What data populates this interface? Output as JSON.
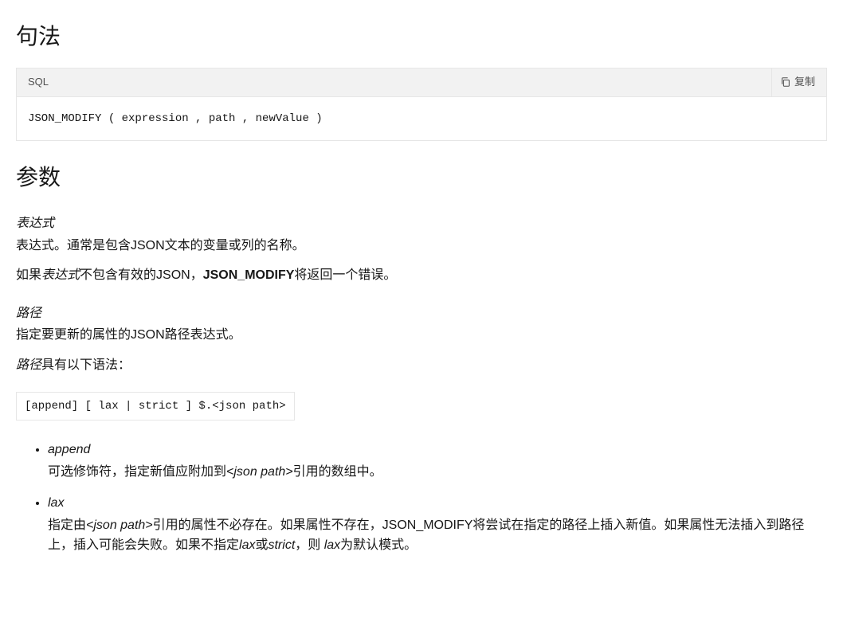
{
  "syntax": {
    "heading": "句法",
    "lang_label": "SQL",
    "copy_label": "复制",
    "code": "JSON_MODIFY ( expression , path , newValue )"
  },
  "params": {
    "heading": "参数",
    "expr": {
      "term": "表达式",
      "desc": "表达式。通常是包含JSON文本的变量或列的名称。",
      "err_prefix": "如果",
      "err_expr": "表达式",
      "err_mid1": "不包含有效的JSON，",
      "err_strong": "JSON_MODIFY",
      "err_suffix": "将返回一个错误。"
    },
    "path": {
      "term": "路径",
      "desc": "指定要更新的属性的JSON路径表达式。",
      "syntax_intro_prefix": "路径",
      "syntax_intro_suffix": "具有以下语法：",
      "syntax_code": "[append] [ lax | strict ] $.<json path>"
    },
    "modifiers": {
      "append": {
        "term": "append",
        "desc_prefix": "可选修饰符，指定新值应附加到",
        "desc_em": "<json path>",
        "desc_suffix": "引用的数组中。"
      },
      "lax": {
        "term": "lax",
        "desc_p1": "指定由",
        "desc_em1": "<json path>",
        "desc_p2": "引用的属性不必存在。如果属性不存在，JSON_MODIFY将尝试在指定的路径上插入新值。如果属性无法插入到路径上，插入可能会失败。如果不指定",
        "desc_em2": "lax",
        "desc_p3": "或",
        "desc_em3": "strict",
        "desc_p4": "，则 ",
        "desc_em4": "lax",
        "desc_p5": "为默认模式。"
      }
    }
  }
}
